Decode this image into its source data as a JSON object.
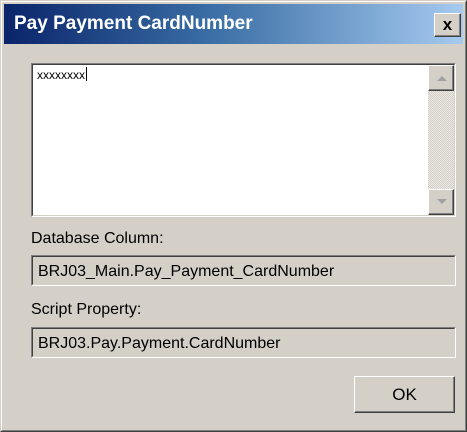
{
  "window": {
    "title": "Pay Payment CardNumber",
    "close_label": "x"
  },
  "memo": {
    "value": "xxxxxxxx"
  },
  "database_column": {
    "label": "Database Column:",
    "value": "BRJ03_Main.Pay_Payment_CardNumber"
  },
  "script_property": {
    "label": "Script Property:",
    "value": "BRJ03.Pay.Payment.CardNumber"
  },
  "buttons": {
    "ok_label": "OK"
  },
  "icons": {
    "close": "close-icon",
    "scroll_up": "scroll-up-arrow-icon",
    "scroll_down": "scroll-down-arrow-icon"
  },
  "colors": {
    "title_bar_start": "#0a246a",
    "title_bar_end": "#a6caf0",
    "dialog_background": "#d4d0c8"
  }
}
